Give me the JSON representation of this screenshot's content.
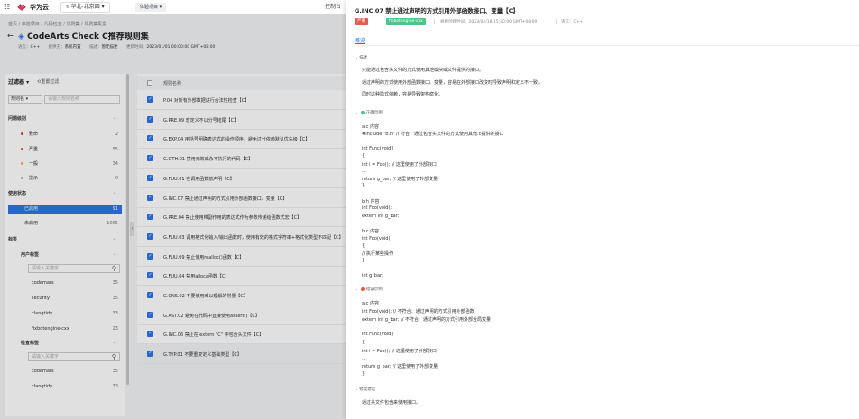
{
  "topbar": {
    "brand": "华为云",
    "region": "华北-北京四",
    "service": "体验项目",
    "console": "控制台"
  },
  "breadcrumb": "首页 / 体验项目 / 代码检查 / 规则集 / 规则集配置",
  "page": {
    "title": "CodeArts Check C推荐规则集",
    "meta": [
      {
        "label": "语言：",
        "value": "C++"
      },
      {
        "label": "提供方：",
        "value": "系统内置"
      },
      {
        "label": "描述：",
        "value": "暂无描述"
      },
      {
        "label": "更新时间：",
        "value": "2023/01/01 00:00:00 GMT+08:00"
      }
    ]
  },
  "filter": {
    "header": "过滤器",
    "reset": "重置过滤",
    "select": "规则名",
    "input_placeholder": "请输入规则名称",
    "severity_title": "问题级别",
    "severity": [
      {
        "label": "致命",
        "count": "2",
        "color": "#d9363e"
      },
      {
        "label": "严重",
        "count": "55",
        "color": "#e8594a"
      },
      {
        "label": "一般",
        "count": "34",
        "color": "#f0b429"
      },
      {
        "label": "提示",
        "count": "0",
        "color": "#b0b0b0"
      }
    ],
    "status_title": "使用状态",
    "status": [
      {
        "label": "已启用",
        "count": "91"
      },
      {
        "label": "未启用",
        "count": "1005"
      }
    ],
    "tags_title": "标签",
    "user_tags_title": "用户标签",
    "search_placeholder": "请输入关键字",
    "user_tags": [
      {
        "label": "codemars",
        "count": "35"
      },
      {
        "label": "security",
        "count": "35"
      },
      {
        "label": "clangtidy",
        "count": "33"
      },
      {
        "label": "fixbotengine-cxx",
        "count": "23"
      }
    ],
    "check_tags_title": "检查标签",
    "check_tags": [
      {
        "label": "codemars",
        "count": "35"
      },
      {
        "label": "clangtidy",
        "count": "33"
      }
    ]
  },
  "table": {
    "header": "规则名称",
    "rows": [
      "P.04 对所有外部数据进行合法性检查【C】",
      "G.PRE.09 宏定义不以分号结尾【C】",
      "G.EXP.04 用括号明确表达式的操作顺序，避免过分依赖默认优先级【C】",
      "G.OTH.01 禁用无效或永不执行的代码【C】",
      "G.FUU.01 在调用函数前声明【C】",
      "G.INC.07 禁止通过声明的方式引用外部函数接口、变量【C】",
      "G.PRE.04 禁止使用带副作用的表达式作为参数传递给函数式宏【C】",
      "G.FUU.03 调用格式化输入/输出函数时，使用有效的格式字符串+格式化类型不匹配【C】",
      "G.FUU.09 禁止使用realloc()函数【C】",
      "G.FUU.04 禁用alloca函数【C】",
      "G.CNS.02 不要使用难以理解的常量【C】",
      "G.AST.02 避免在代码中直接使用assert()【C】",
      "G.INC.06 禁止在 extern \"C\" 中包含头文件【C】",
      "G.TYP.01 不要重复定义基础类型【C】"
    ]
  },
  "drawer": {
    "title": "G.INC.07 禁止通过声明的方式引用外部函数接口、变量【C】",
    "severity_badge": "严重",
    "tag_badge": "fixbotengine-cxx",
    "time_label": "规则创建时间：2023/04/18 15:30:00 GMT+08:00",
    "lang_label": "语言：C++",
    "tab": "概览",
    "desc_title": "描述",
    "desc_lines": [
      "只能通过包含头文件的方式使用其他模块或文件提供的接口。",
      "通过声明的方式使用外部函数接口、变量，容易在外部接口改变时导致声明和定义不一致。",
      "同时这种隐式依赖，容易导致架构腐化。"
    ],
    "correct_title": "正确示例",
    "correct_lines": [
      "a.c 内容",
      "#include \"b.h\"  // 符合：通过包含头文件的方式使用其他.c提供的接口",
      "",
      "int Func(void)",
      "{",
      "    int i = Foo();  // 这里使用了外部接口",
      "    ...",
      "    return g_bar;  // 这里使用了外部变量",
      "}",
      "",
      "b.h 内容",
      "int Foo(void);",
      "extern int g_bar;",
      "",
      "b.c 内容",
      "int Foo(void)",
      "{",
      "    // 执行某些操作",
      "}",
      "",
      "int g_bar;"
    ],
    "wrong_title": "错误示例",
    "wrong_lines": [
      "a.c 内容",
      "int Foo(void);  // 不符合：通过声明的方式引用外部函数",
      "extern int g_bar;  // 不符合：通过声明的方式引用外部全局变量",
      "",
      "int Func(void)",
      "{",
      "    int i = Foo();  // 这里使用了外部接口",
      "    ...",
      "    return g_bar;  // 这里使用了外部变量",
      "}"
    ],
    "fix_title": "修复建议",
    "fix_lines": [
      "通过头文件包含来使用接口。"
    ]
  },
  "colors": {
    "primary": "#2f75e8",
    "severe": "#e8594a",
    "tag_green": "#4cc58b"
  }
}
